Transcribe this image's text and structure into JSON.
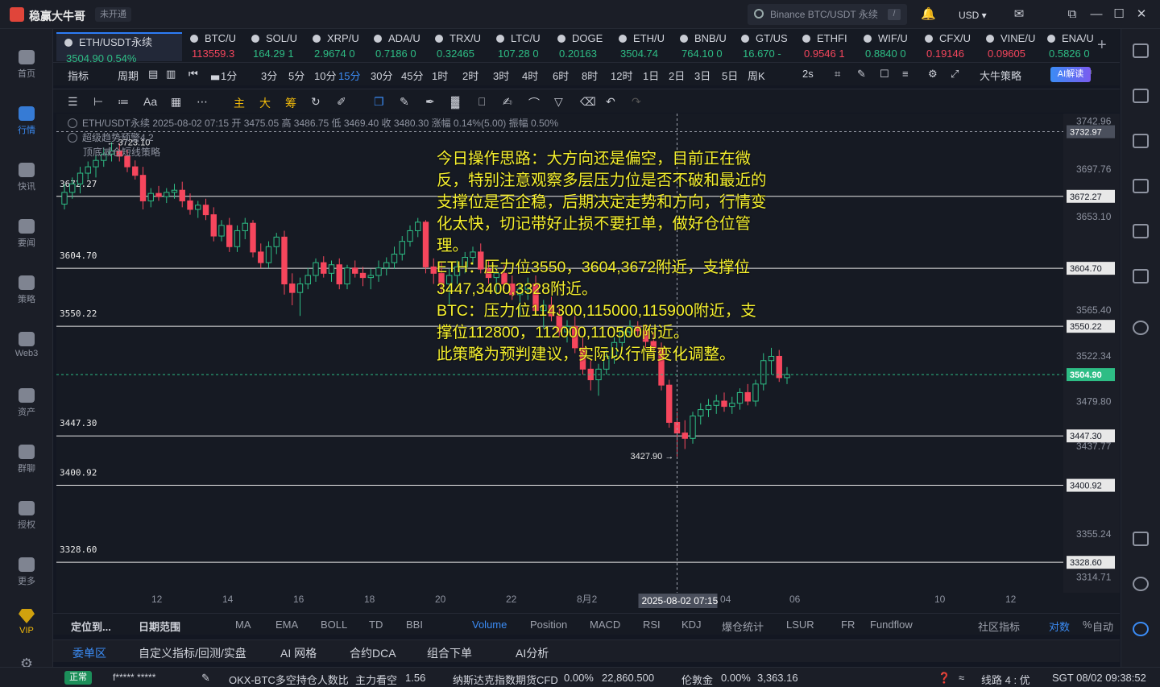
{
  "app": {
    "name": "稳赢大牛哥",
    "status": "未开通",
    "search_placeholder": "Binance BTC/USDT 永续",
    "search_hotkey": "/",
    "currency": "USD"
  },
  "sidebar": [
    {
      "label": "首页"
    },
    {
      "label": "行情",
      "active": true
    },
    {
      "label": "快讯"
    },
    {
      "label": "要闻"
    },
    {
      "label": "策略"
    },
    {
      "label": "Web3"
    },
    {
      "label": "资产"
    },
    {
      "label": "群聊"
    },
    {
      "label": "授权"
    },
    {
      "label": "更多"
    },
    {
      "label": "VIP",
      "vip": true
    }
  ],
  "tickers": [
    {
      "sym": "ETH/USDT永续",
      "px": "3504.90  0.54%",
      "dir": "up",
      "active": true
    },
    {
      "sym": "BTC/U",
      "px": "113559.3",
      "dir": "dn"
    },
    {
      "sym": "SOL/U",
      "px": "164.29  1",
      "dir": "up"
    },
    {
      "sym": "XRP/U",
      "px": "2.9674  0",
      "dir": "up"
    },
    {
      "sym": "ADA/U",
      "px": "0.7186  0",
      "dir": "up"
    },
    {
      "sym": "TRX/U",
      "px": "0.32465",
      "dir": "up"
    },
    {
      "sym": "LTC/U",
      "px": "107.28  0",
      "dir": "up"
    },
    {
      "sym": "DOGE",
      "px": "0.20163",
      "dir": "up"
    },
    {
      "sym": "ETH/U",
      "px": "3504.74",
      "dir": "up"
    },
    {
      "sym": "BNB/U",
      "px": "764.10  0",
      "dir": "up"
    },
    {
      "sym": "GT/US",
      "px": "16.670  -",
      "dir": "up"
    },
    {
      "sym": "ETHFI",
      "px": "0.9546  1",
      "dir": "dn"
    },
    {
      "sym": "WIF/U",
      "px": "0.8840  0",
      "dir": "up"
    },
    {
      "sym": "CFX/U",
      "px": "0.19146",
      "dir": "dn"
    },
    {
      "sym": "VINE/U",
      "px": "0.09605",
      "dir": "dn"
    },
    {
      "sym": "ENA/U",
      "px": "0.5826  0",
      "dir": "up"
    }
  ],
  "periods": [
    "指标",
    "周期",
    "1分",
    "3分",
    "5分",
    "10分",
    "15分",
    "30分",
    "45分",
    "1时",
    "2时",
    "3时",
    "4时",
    "6时",
    "8时",
    "12时",
    "1日",
    "2日",
    "3日",
    "5日",
    "周K",
    "2s",
    "大牛策略",
    "AI解读"
  ],
  "selected_period": "15分",
  "draw_tools": [
    "主",
    "大",
    "筹"
  ],
  "legend": {
    "line1": "ETH/USDT永续  2025-08-02 07:15  开 3475.05  高 3486.75  低 3469.40  收 3480.30  涨幅 0.14%(5.00)  振幅 0.50%",
    "line2": "超级趋势预警4.2",
    "line3": "顶底减仓短线策略"
  },
  "annotation": "今日操作思路：大方向还是偏空，目前正在微反，特别注意观察多层压力位是否不破和最近的支撑位是否企稳，后期决定走势和方向，行情变化太快，切记带好止损不要扛单，做好仓位管理。\nETH：压力位3550，3604,3672附近，支撑位3447,3400,3328附近。\nBTC：压力位114300,115000,115900附近，支撑位112800，112000,110500附近。\n此策略为预判建议，实际以行情变化调整。",
  "chart_data": {
    "type": "candlestick",
    "symbol": "ETH/USDT永续",
    "interval": "15分",
    "y_range": [
      3300,
      3750
    ],
    "y_ticks": [
      "3742.96",
      "3697.76",
      "3653.10",
      "3565.40",
      "3522.34",
      "3479.80",
      "3437.77",
      "3355.24",
      "3314.71"
    ],
    "x_ticks": [
      "12",
      "14",
      "16",
      "18",
      "20",
      "22",
      "8月2",
      "02",
      "04",
      "06",
      "10",
      "12"
    ],
    "crosshair_time": "2025-08-02 07:15",
    "crosshair_price": "3732.97",
    "last_price": "3504.90",
    "high_mark": "3723.10",
    "low_mark": "3427.90",
    "levels": [
      "3672.27",
      "3604.70",
      "3550.22",
      "3447.30",
      "3400.92",
      "3328.60"
    ],
    "ohlc": [
      [
        3665,
        3684,
        3660,
        3676
      ],
      [
        3676,
        3690,
        3670,
        3684
      ],
      [
        3684,
        3700,
        3675,
        3694
      ],
      [
        3694,
        3705,
        3688,
        3700
      ],
      [
        3700,
        3712,
        3690,
        3706
      ],
      [
        3706,
        3718,
        3700,
        3712
      ],
      [
        3712,
        3723,
        3705,
        3715
      ],
      [
        3715,
        3722,
        3705,
        3710
      ],
      [
        3710,
        3716,
        3695,
        3700
      ],
      [
        3700,
        3706,
        3688,
        3692
      ],
      [
        3692,
        3700,
        3660,
        3668
      ],
      [
        3668,
        3680,
        3662,
        3675
      ],
      [
        3675,
        3682,
        3668,
        3672
      ],
      [
        3672,
        3680,
        3666,
        3676
      ],
      [
        3676,
        3684,
        3670,
        3678
      ],
      [
        3678,
        3686,
        3662,
        3668
      ],
      [
        3668,
        3675,
        3655,
        3660
      ],
      [
        3660,
        3668,
        3652,
        3664
      ],
      [
        3664,
        3670,
        3650,
        3655
      ],
      [
        3655,
        3662,
        3630,
        3635
      ],
      [
        3635,
        3650,
        3630,
        3645
      ],
      [
        3645,
        3652,
        3620,
        3625
      ],
      [
        3625,
        3645,
        3620,
        3640
      ],
      [
        3640,
        3652,
        3632,
        3647
      ],
      [
        3647,
        3650,
        3615,
        3620
      ],
      [
        3620,
        3628,
        3605,
        3610
      ],
      [
        3610,
        3630,
        3605,
        3625
      ],
      [
        3625,
        3638,
        3618,
        3634
      ],
      [
        3634,
        3640,
        3580,
        3590
      ],
      [
        3590,
        3600,
        3570,
        3582
      ],
      [
        3582,
        3596,
        3560,
        3590
      ],
      [
        3590,
        3605,
        3585,
        3598
      ],
      [
        3598,
        3614,
        3592,
        3610
      ],
      [
        3610,
        3616,
        3596,
        3600
      ],
      [
        3600,
        3612,
        3592,
        3608
      ],
      [
        3608,
        3614,
        3585,
        3590
      ],
      [
        3590,
        3608,
        3585,
        3605
      ],
      [
        3605,
        3612,
        3596,
        3600
      ],
      [
        3600,
        3606,
        3588,
        3596
      ],
      [
        3596,
        3604,
        3585,
        3598
      ],
      [
        3598,
        3612,
        3592,
        3605
      ],
      [
        3605,
        3615,
        3598,
        3610
      ],
      [
        3610,
        3625,
        3604,
        3618
      ],
      [
        3618,
        3635,
        3612,
        3630
      ],
      [
        3630,
        3645,
        3625,
        3640
      ],
      [
        3640,
        3652,
        3634,
        3648
      ],
      [
        3648,
        3650,
        3600,
        3606
      ],
      [
        3606,
        3614,
        3590,
        3600
      ],
      [
        3600,
        3610,
        3580,
        3590
      ],
      [
        3590,
        3604,
        3570,
        3598
      ],
      [
        3598,
        3612,
        3590,
        3606
      ],
      [
        3606,
        3620,
        3600,
        3615
      ],
      [
        3615,
        3625,
        3608,
        3620
      ],
      [
        3620,
        3628,
        3600,
        3604
      ],
      [
        3604,
        3612,
        3590,
        3596
      ],
      [
        3596,
        3606,
        3580,
        3600
      ],
      [
        3600,
        3608,
        3585,
        3590
      ],
      [
        3590,
        3598,
        3575,
        3580
      ],
      [
        3580,
        3590,
        3560,
        3585
      ],
      [
        3585,
        3596,
        3575,
        3590
      ],
      [
        3590,
        3598,
        3560,
        3565
      ],
      [
        3565,
        3575,
        3548,
        3570
      ],
      [
        3570,
        3578,
        3555,
        3560
      ],
      [
        3560,
        3568,
        3540,
        3545
      ],
      [
        3545,
        3556,
        3535,
        3550
      ],
      [
        3550,
        3560,
        3525,
        3530
      ],
      [
        3530,
        3540,
        3505,
        3510
      ],
      [
        3510,
        3520,
        3490,
        3500
      ],
      [
        3500,
        3515,
        3485,
        3510
      ],
      [
        3510,
        3528,
        3505,
        3522
      ],
      [
        3522,
        3540,
        3515,
        3535
      ],
      [
        3535,
        3550,
        3528,
        3545
      ],
      [
        3545,
        3556,
        3540,
        3550
      ],
      [
        3550,
        3555,
        3540,
        3546
      ],
      [
        3546,
        3552,
        3530,
        3536
      ],
      [
        3536,
        3545,
        3520,
        3530
      ],
      [
        3530,
        3535,
        3490,
        3495
      ],
      [
        3495,
        3500,
        3455,
        3460
      ],
      [
        3460,
        3470,
        3428,
        3450
      ],
      [
        3450,
        3462,
        3435,
        3445
      ],
      [
        3445,
        3470,
        3440,
        3466
      ],
      [
        3466,
        3478,
        3458,
        3472
      ],
      [
        3472,
        3482,
        3465,
        3476
      ],
      [
        3476,
        3486,
        3468,
        3480
      ],
      [
        3480,
        3488,
        3470,
        3475
      ],
      [
        3475,
        3484,
        3468,
        3478
      ],
      [
        3478,
        3492,
        3472,
        3488
      ],
      [
        3488,
        3496,
        3476,
        3480
      ],
      [
        3480,
        3500,
        3475,
        3496
      ],
      [
        3496,
        3525,
        3490,
        3518
      ],
      [
        3518,
        3530,
        3505,
        3522
      ],
      [
        3522,
        3528,
        3498,
        3502
      ],
      [
        3502,
        3512,
        3496,
        3505
      ]
    ]
  },
  "indicator_tabs": [
    "定位到...",
    "日期范围",
    "MA",
    "EMA",
    "BOLL",
    "TD",
    "BBI",
    "Volume",
    "Position",
    "MACD",
    "RSI",
    "KDJ",
    "爆仓统计",
    "LSUR",
    "FR",
    "Fundflow",
    "社区指标",
    "对数",
    "%",
    "自动"
  ],
  "panel_tabs": [
    "委单区",
    "自定义指标/回测/实盘",
    "AI 网格",
    "合约DCA",
    "组合下单",
    "AI分析"
  ],
  "statusbar": {
    "badge": "正常",
    "user": "f*****  *****",
    "item1": "OKX-BTC多空持仓人数比",
    "item1_tag": "主力看空",
    "item1_val": "1.56",
    "item2": "纳斯达克指数期货CFD",
    "item2_chg": "0.00%",
    "item2_val": "22,860.500",
    "item3": "伦敦金",
    "item3_chg": "0.00%",
    "item3_val": "3,363.16",
    "line": "线路 4 : 优",
    "time": "SGT 08/02 09:38:52"
  }
}
